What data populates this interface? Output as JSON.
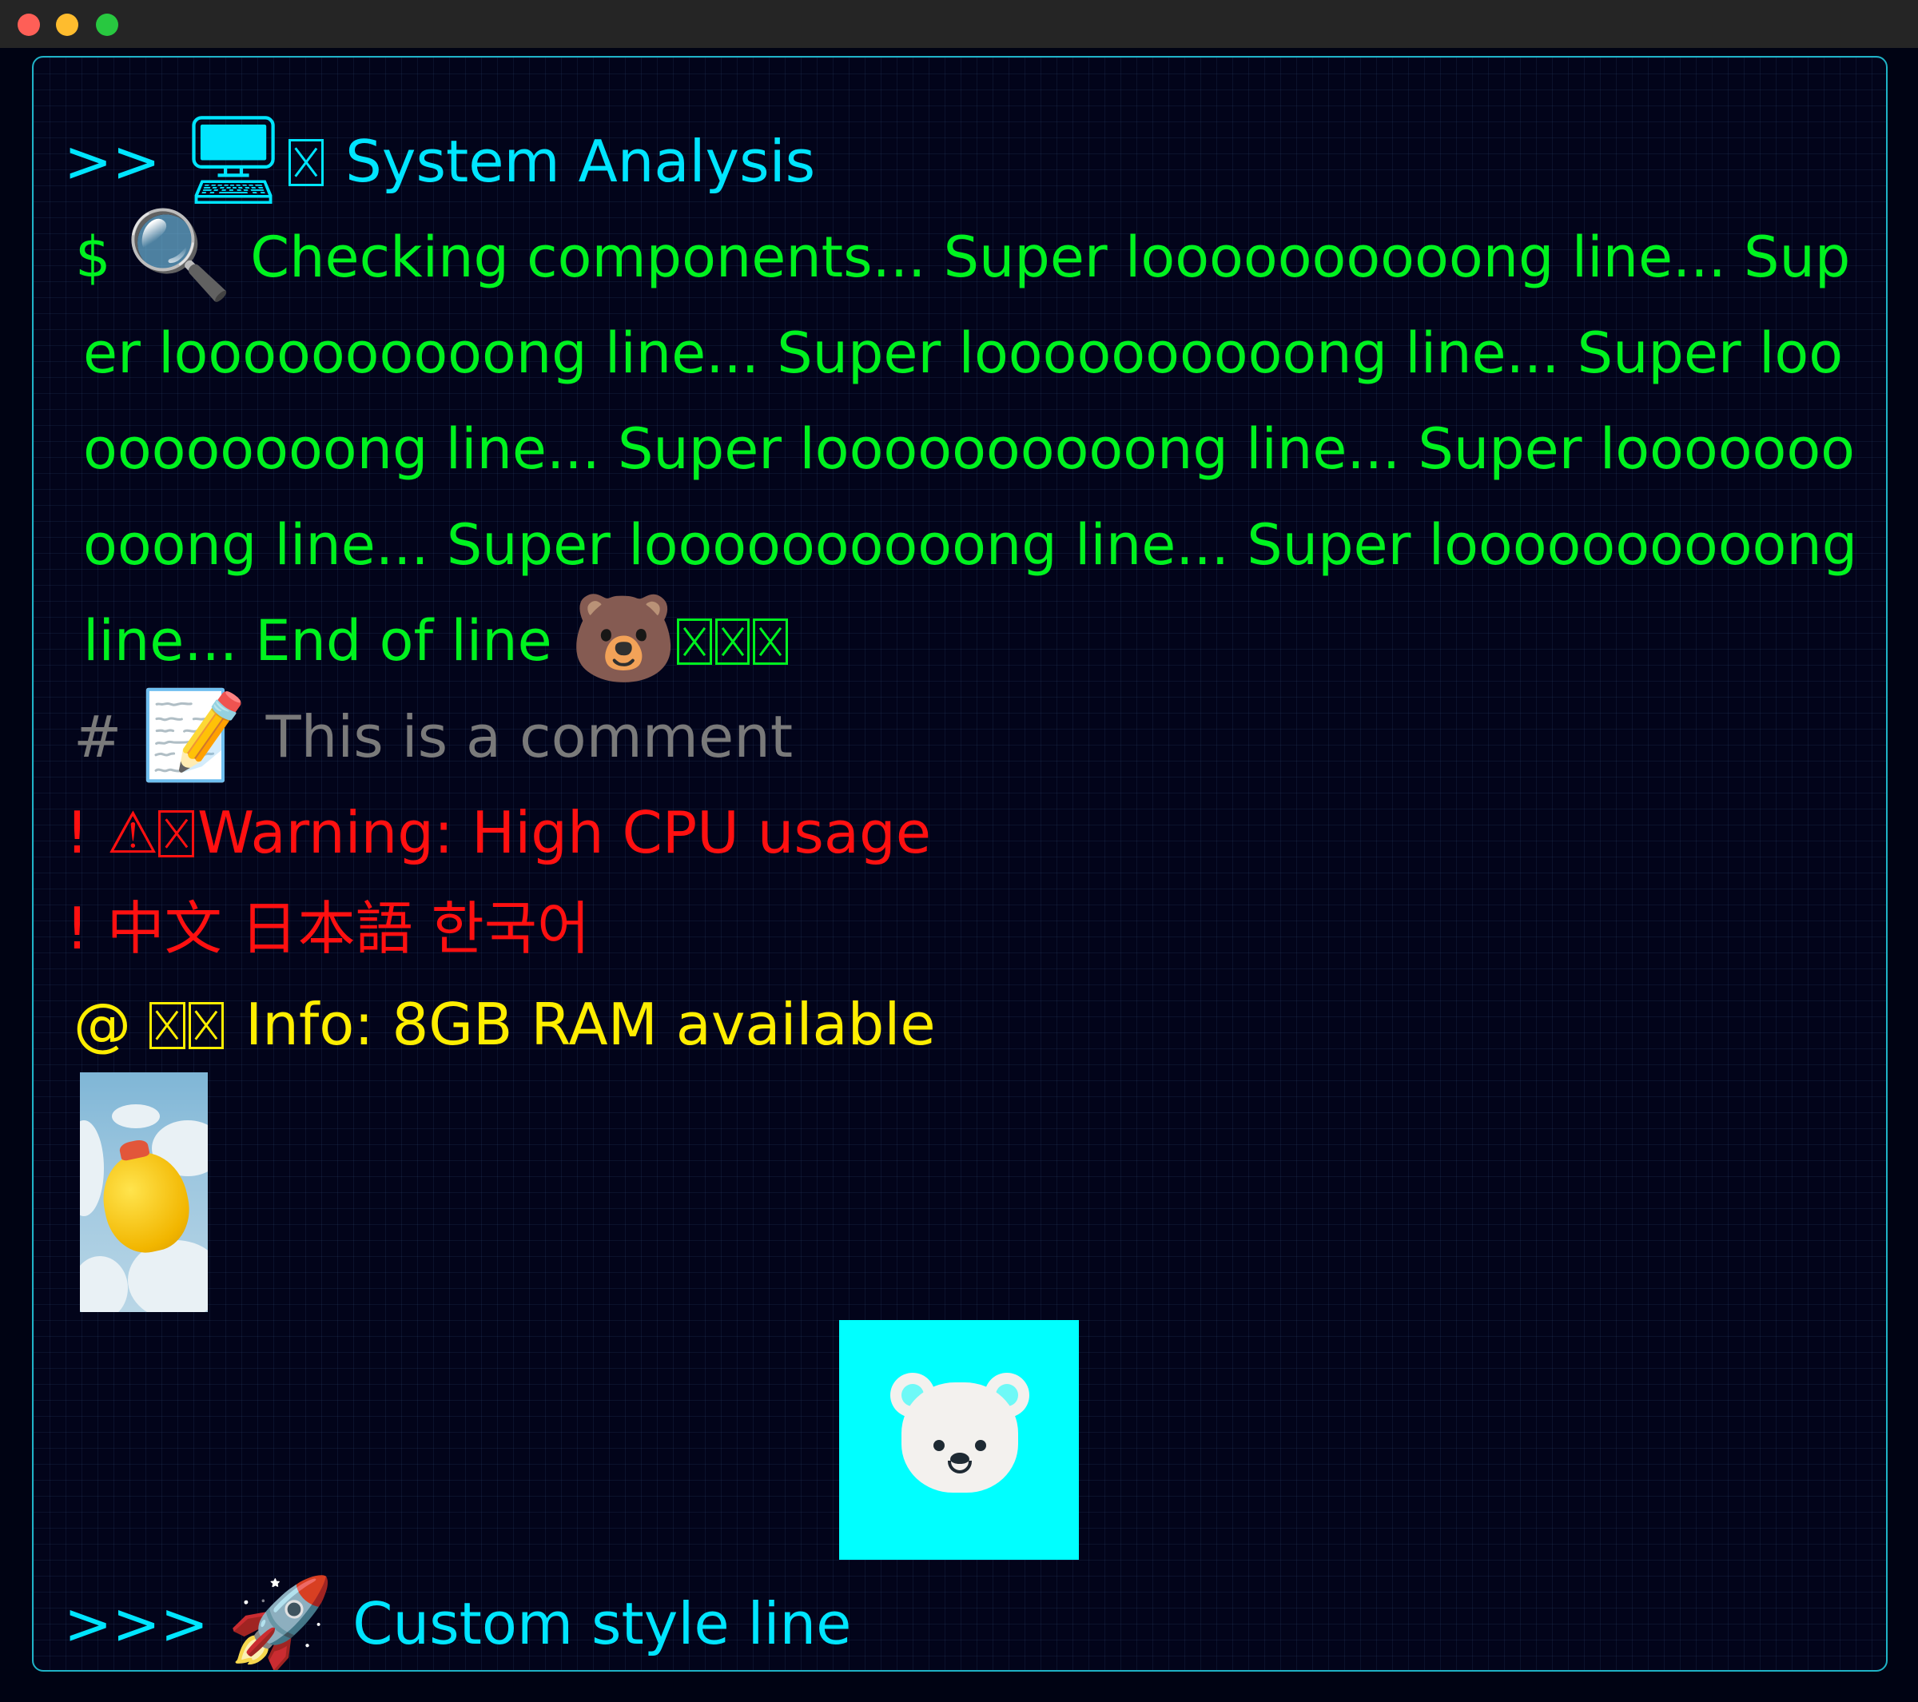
{
  "window": {
    "controls": [
      "close",
      "minimize",
      "zoom"
    ]
  },
  "lines": {
    "header": {
      "prompt": ">>",
      "icon": "desktop-computer-emoji",
      "text": "System Analysis"
    },
    "checking": {
      "prompt": "$",
      "icon": "magnifying-glass-emoji",
      "text": "Checking components... Super loooooooooong line... Super loooooooooong line... Super loooooooooong line... Super loooooooooong line... Super loooooooooong line... Super loooooooooong line... Super loooooooooong line... Super loooooooooong line... End of line",
      "trailing_icon": "bear-face-emoji"
    },
    "comment": {
      "prompt": "#",
      "icon": "memo-emoji",
      "text": "This is a comment"
    },
    "warning": {
      "prompt": "!",
      "icon": "warning-emoji",
      "text": "Warning: High CPU usage"
    },
    "cjk": {
      "prompt": "!",
      "text": "中文 日本語 한국어"
    },
    "info": {
      "prompt": "@",
      "text": "Info: 8GB RAM available"
    },
    "custom": {
      "prompt": ">>>",
      "icon": "rocket-emoji",
      "text": "Custom style line"
    }
  },
  "images": {
    "balloon": "yellow-balloon-in-clouds-image",
    "bear": "polar-bear-tile-image"
  },
  "colors": {
    "header": "#00e5ff",
    "output": "#00f21f",
    "comment": "#7a7a7a",
    "warning": "#ff1010",
    "info": "#ffee00",
    "bear_tile": "#00ffff",
    "border": "#1fb3c7"
  }
}
